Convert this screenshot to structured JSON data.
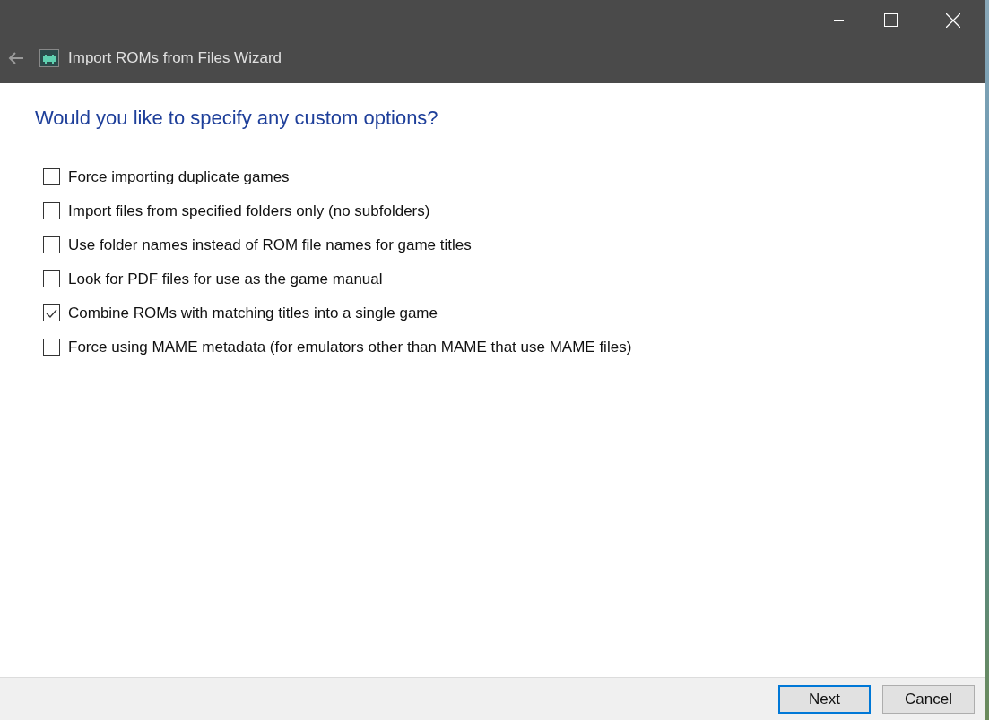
{
  "window": {
    "title": "Import ROMs from Files Wizard"
  },
  "heading": "Would you like to specify any custom options?",
  "options": [
    {
      "label": "Force importing duplicate games",
      "checked": false
    },
    {
      "label": "Import files from specified folders only (no subfolders)",
      "checked": false
    },
    {
      "label": "Use folder names instead of ROM file names for game titles",
      "checked": false
    },
    {
      "label": "Look for PDF files for use as the game manual",
      "checked": false
    },
    {
      "label": "Combine ROMs with matching titles into a single game",
      "checked": true
    },
    {
      "label": "Force using MAME metadata (for emulators other than MAME that use MAME files)",
      "checked": false
    }
  ],
  "buttons": [
    {
      "label": "Next",
      "default": true
    },
    {
      "label": "Cancel",
      "default": false
    }
  ]
}
